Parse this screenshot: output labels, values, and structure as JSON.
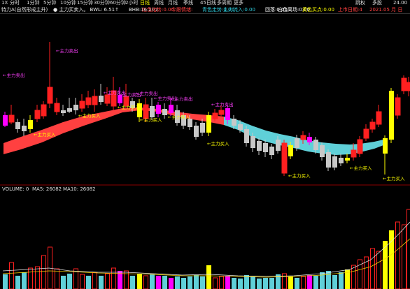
{
  "toolbar": {
    "menu_icon_label": "1X",
    "periods": [
      "分时",
      "1分钟",
      "5分钟",
      "10分钟",
      "15分钟",
      "30分钟",
      "60分钟",
      "2小时",
      "日线",
      "周线",
      "月线",
      "季线",
      "45日线",
      "多周期",
      "更多"
    ],
    "active_period": "日线",
    "right": [
      "跳权",
      "多股",
      "24.00"
    ]
  },
  "indicator_bar": {
    "stock": "特力A(自然形成主升)",
    "items": [
      {
        "text": "● 主力买卖入。 BWL: 6.51↑",
        "color": "#e6e6e6"
      },
      {
        "text": "BHB:16.20↓",
        "color": "#e6e6e6"
      },
      {
        "text": "红色抬势:0.00",
        "color": "#ff4040"
      },
      {
        "text": "今跟情绪:",
        "color": "#ff4040"
      },
      {
        "text": "青色走势:0.00",
        "color": "#2ecfe0"
      },
      {
        "text": "主力流入:0.00",
        "color": "#2ecfe0"
      },
      {
        "text": "回落:0.00",
        "color": "#ffffff"
      },
      {
        "text": "白色离场:0.00",
        "color": "#ffffff"
      },
      {
        "text": "黄色买点:0.00",
        "color": "#ffff00"
      },
      {
        "text": "上市日期:4",
        "color": "#ff4040"
      },
      {
        "text": "2021.05 月 日",
        "color": "#ff4040"
      }
    ]
  },
  "volume_bar": {
    "label": "VOLUME: 0",
    "ma5": "MA5: 26082",
    "ma10": "MA10: 26082"
  },
  "annotations": [
    {
      "text": "←主力卖出",
      "color": "#ff40ff"
    },
    {
      "text": "←主力卖出",
      "color": "#ff40ff"
    },
    {
      "text": "←主力卖出",
      "color": "#ff40ff"
    },
    {
      "text": "←主力卖出",
      "color": "#ff40ff"
    },
    {
      "text": "←主力卖出",
      "color": "#ff40ff"
    },
    {
      "text": "←主力卖出",
      "color": "#ff40ff"
    },
    {
      "text": "←主力卖出",
      "color": "#ff40ff"
    },
    {
      "text": "←主力卖出",
      "color": "#ff40ff"
    },
    {
      "text": "←主力买入",
      "color": "#ffff00"
    },
    {
      "text": "←主力买入",
      "color": "#ffff00"
    },
    {
      "text": "←主力买入",
      "color": "#ffff00"
    },
    {
      "text": "←主力买入",
      "color": "#ffff00"
    },
    {
      "text": "←主力买入",
      "color": "#ffff00"
    },
    {
      "text": "←主力买入",
      "color": "#ffff00"
    },
    {
      "text": "←主力买入",
      "color": "#ffff00"
    },
    {
      "text": "←主力买入",
      "color": "#ffff00"
    },
    {
      "text": "←主力买入",
      "color": "#ffff00"
    }
  ],
  "colors": {
    "up": "#ff2020",
    "down": "#c8c8c8",
    "buy": "#ffff00",
    "sell": "#ff00ff",
    "band_red": "#ff4040",
    "band_cyan": "#5fd0d8",
    "grid": "#8b0000",
    "ma": "#e0e0e0"
  }
}
